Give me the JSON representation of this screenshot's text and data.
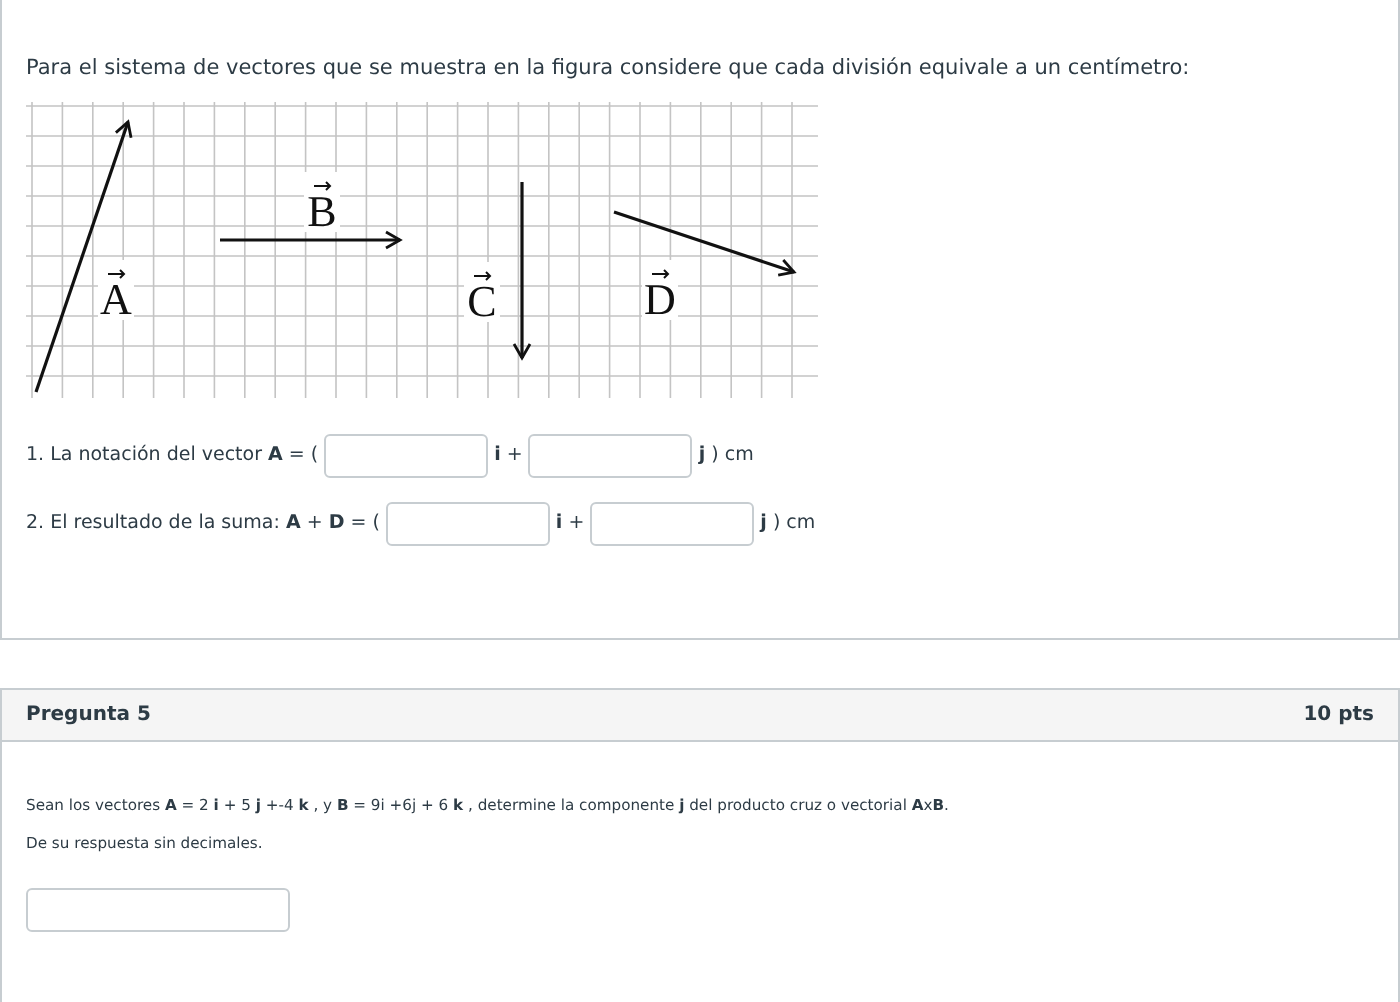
{
  "question_top": {
    "intro": "Para el sistema de vectores que se muestra en la figura considere que cada división equivale a un centímetro:",
    "figure": {
      "vectors": [
        {
          "label": "A"
        },
        {
          "label": "B"
        },
        {
          "label": "C"
        },
        {
          "label": "D"
        }
      ]
    },
    "items": [
      {
        "prompt": "1. La notación del vector **A** = (",
        "i_label": "**i** +",
        "j_label": "**j** ) cm"
      },
      {
        "prompt": "2. El resultado de la suma:  **A** + **D** = (",
        "i_label": "**i** +",
        "j_label": "**j** ) cm"
      }
    ]
  },
  "question_5": {
    "title": "Pregunta 5",
    "points": "10 pts",
    "statement": "Sean los vectores **A** = 2 **i** + 5 **j** +-4 **k** , y **B** = 9i +6j + 6 **k** , determine la componente **j** del producto cruz o vectorial  **A**x**B**.",
    "note": "De su respuesta sin decimales."
  }
}
